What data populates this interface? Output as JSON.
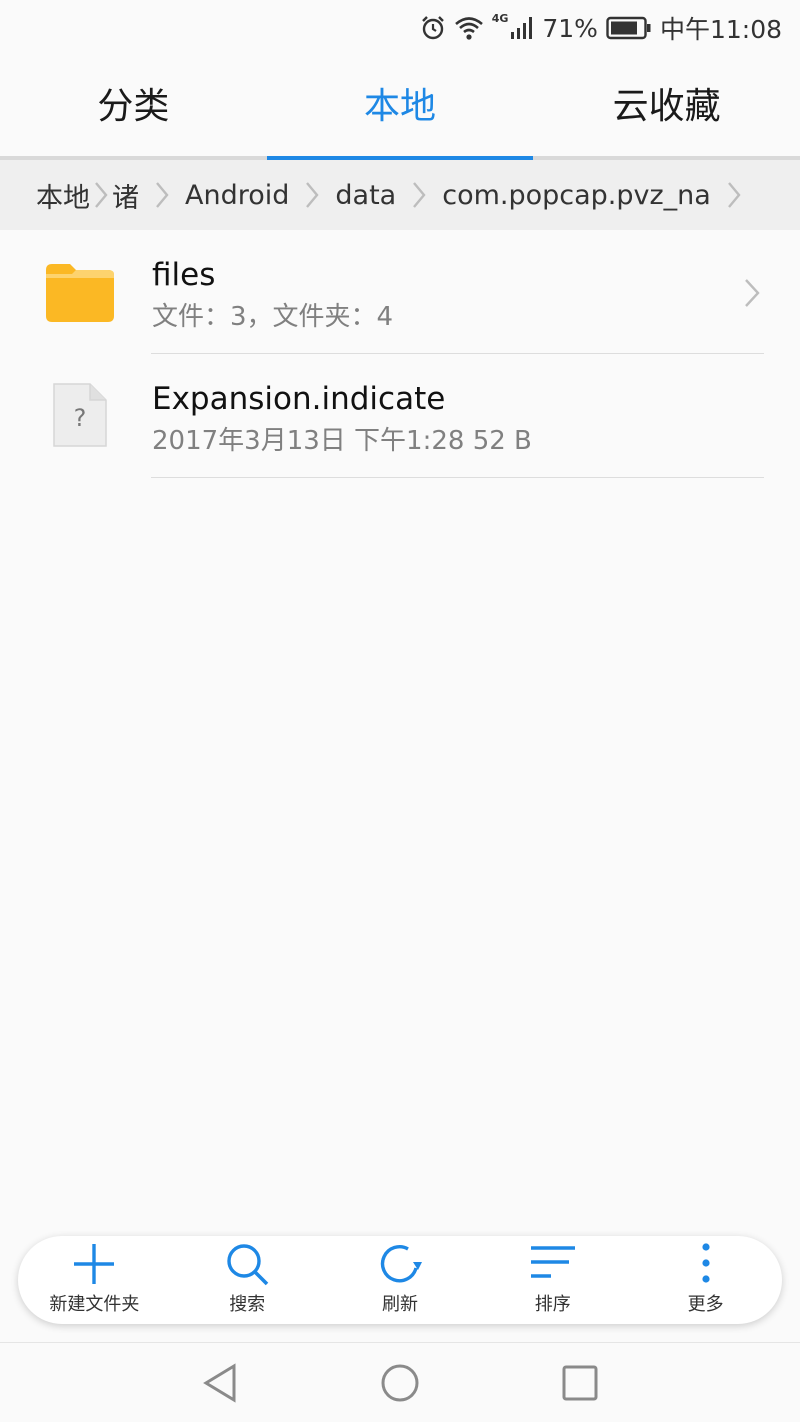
{
  "status_bar": {
    "network": "4G",
    "battery": "71%",
    "time": "中午11:08",
    "icons": [
      "alarm-icon",
      "wifi-icon",
      "signal-icon",
      "battery-icon"
    ]
  },
  "tabs": [
    {
      "label": "分类",
      "active": false
    },
    {
      "label": "本地",
      "active": true
    },
    {
      "label": "云收藏",
      "active": false
    }
  ],
  "breadcrumb": [
    "本地",
    "诸",
    "Android",
    "data",
    "com.popcap.pvz_na"
  ],
  "files": [
    {
      "name": "files",
      "meta": "文件：3，文件夹：4",
      "type": "folder",
      "icon": "folder-icon"
    },
    {
      "name": "Expansion.indicate",
      "meta": "2017年3月13日 下午1:28 52 B",
      "type": "unknown",
      "icon": "unknown-file-icon"
    }
  ],
  "toolbar": {
    "new_folder": "新建文件夹",
    "search": "搜索",
    "refresh": "刷新",
    "sort": "排序",
    "more": "更多"
  },
  "colors": {
    "accent": "#1e88e5",
    "folder": "#fbb824",
    "background": "#fafafa"
  }
}
